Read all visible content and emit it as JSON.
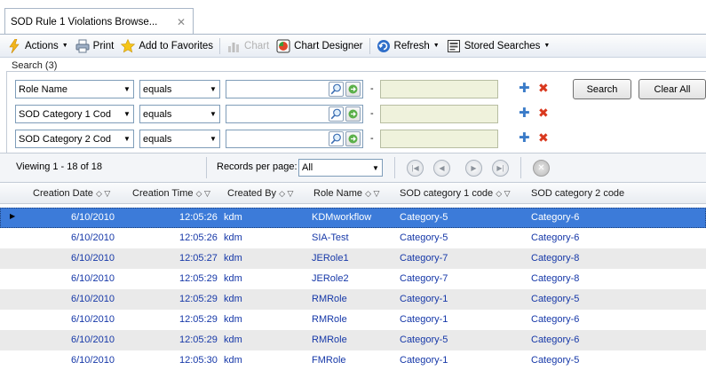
{
  "tab": {
    "title": "SOD Rule 1 Violations Browse...",
    "close": "✕"
  },
  "toolbar": {
    "actions": "Actions",
    "print": "Print",
    "favorites": "Add to Favorites",
    "chart": "Chart",
    "chart_designer": "Chart Designer",
    "refresh": "Refresh",
    "stored_searches": "Stored Searches"
  },
  "search": {
    "header": "Search (3)",
    "rows": [
      {
        "field": "Role Name",
        "operator": "equals",
        "value": "",
        "value2": ""
      },
      {
        "field": "SOD Category 1 Cod",
        "operator": "equals",
        "value": "",
        "value2": ""
      },
      {
        "field": "SOD Category 2 Cod",
        "operator": "equals",
        "value": "",
        "value2": ""
      }
    ],
    "dash": "-",
    "search_button": "Search",
    "clear_button": "Clear All"
  },
  "paging": {
    "viewing": "Viewing 1 - 18  of 18",
    "records_label": "Records per page:",
    "records_value": "All"
  },
  "grid": {
    "columns": [
      "Creation Date",
      "Creation Time",
      "Created By",
      "Role Name",
      "SOD category 1 code",
      "SOD category 2 code"
    ],
    "rows": [
      {
        "date": "6/10/2010",
        "time": "12:05:26",
        "by": "kdm",
        "role": "KDMworkflow",
        "cat1": "Category-5",
        "cat2": "Category-6"
      },
      {
        "date": "6/10/2010",
        "time": "12:05:26",
        "by": "kdm",
        "role": "SIA-Test",
        "cat1": "Category-5",
        "cat2": "Category-6"
      },
      {
        "date": "6/10/2010",
        "time": "12:05:27",
        "by": "kdm",
        "role": "JERole1",
        "cat1": "Category-7",
        "cat2": "Category-8"
      },
      {
        "date": "6/10/2010",
        "time": "12:05:29",
        "by": "kdm",
        "role": "JERole2",
        "cat1": "Category-7",
        "cat2": "Category-8"
      },
      {
        "date": "6/10/2010",
        "time": "12:05:29",
        "by": "kdm",
        "role": "RMRole",
        "cat1": "Category-1",
        "cat2": "Category-5"
      },
      {
        "date": "6/10/2010",
        "time": "12:05:29",
        "by": "kdm",
        "role": "RMRole",
        "cat1": "Category-1",
        "cat2": "Category-6"
      },
      {
        "date": "6/10/2010",
        "time": "12:05:29",
        "by": "kdm",
        "role": "RMRole",
        "cat1": "Category-5",
        "cat2": "Category-6"
      },
      {
        "date": "6/10/2010",
        "time": "12:05:30",
        "by": "kdm",
        "role": "FMRole",
        "cat1": "Category-1",
        "cat2": "Category-5"
      }
    ]
  },
  "colors": {
    "selected_row": "#3c7bd9",
    "alt_row": "#eaeaea",
    "link_text": "#1638a8"
  }
}
